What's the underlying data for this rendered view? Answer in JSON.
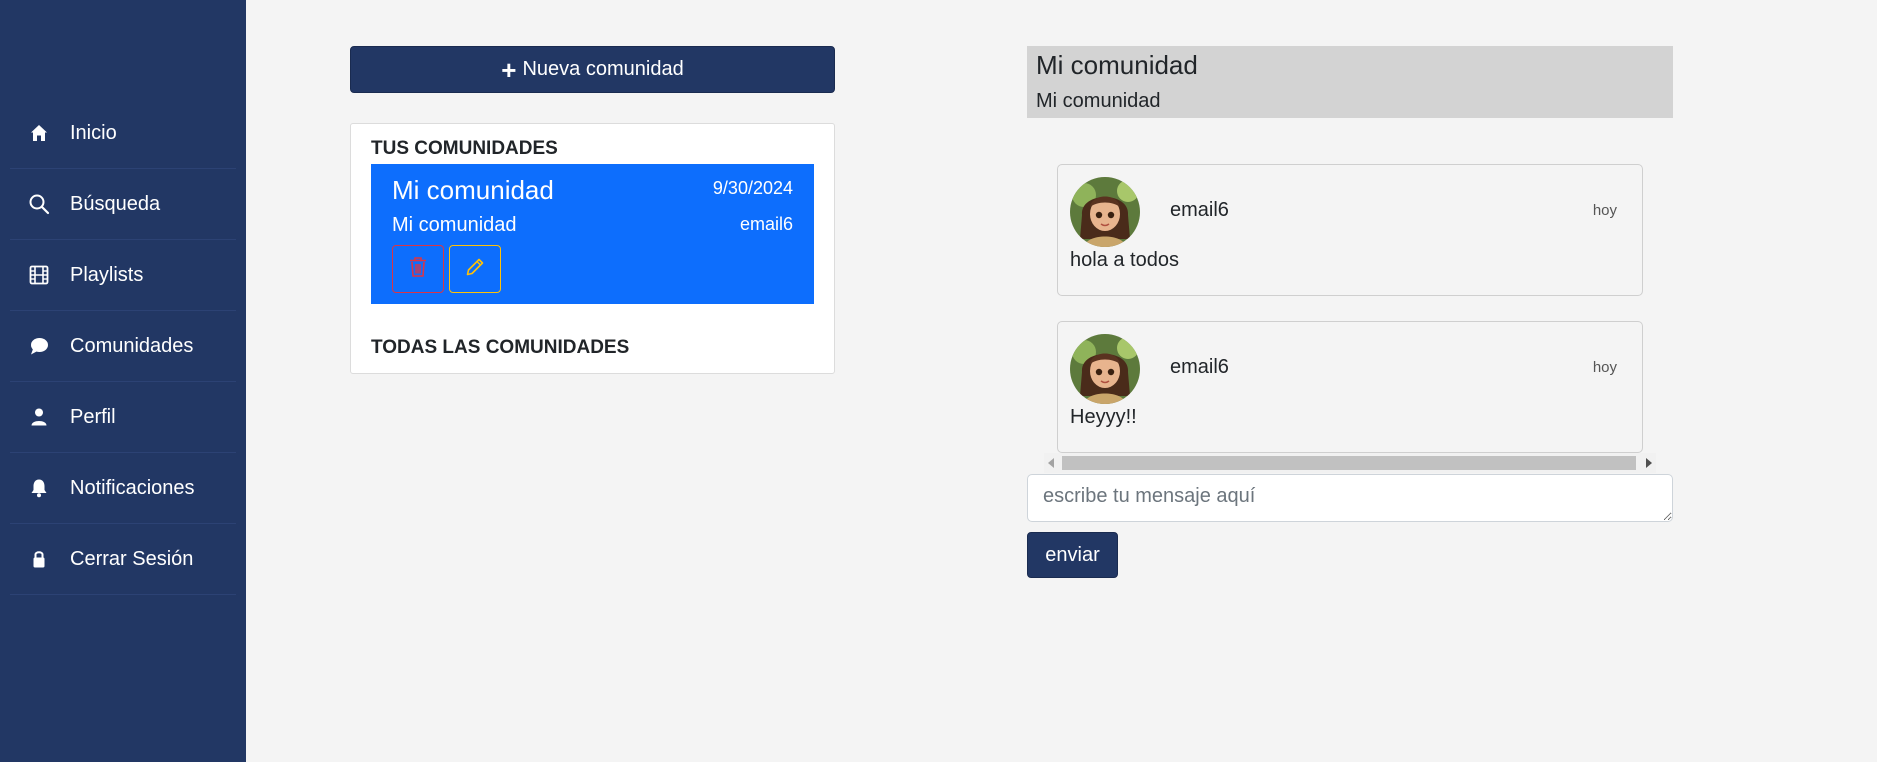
{
  "sidebar": {
    "items": [
      {
        "label": "Inicio",
        "icon": "home-icon"
      },
      {
        "label": "Búsqueda",
        "icon": "search-icon"
      },
      {
        "label": "Playlists",
        "icon": "film-icon"
      },
      {
        "label": "Comunidades",
        "icon": "chat-bubble-icon"
      },
      {
        "label": "Perfil",
        "icon": "user-icon"
      },
      {
        "label": "Notificaciones",
        "icon": "bell-icon"
      },
      {
        "label": "Cerrar Sesión",
        "icon": "lock-icon"
      }
    ]
  },
  "communities": {
    "new_button_label": "Nueva comunidad",
    "my_section_title": "TUS COMUNIDADES",
    "all_section_title": "TODAS LAS COMUNIDADES",
    "my_items": [
      {
        "title": "Mi comunidad",
        "date": "9/30/2024",
        "description": "Mi comunidad",
        "owner": "email6"
      }
    ]
  },
  "chat": {
    "title": "Mi comunidad",
    "description": "Mi comunidad",
    "messages": [
      {
        "user": "email6",
        "time": "hoy",
        "text": "hola a todos"
      },
      {
        "user": "email6",
        "time": "hoy",
        "text": "Heyyy!!"
      }
    ],
    "input_placeholder": "escribe tu mensaje aquí",
    "send_label": "enviar"
  },
  "colors": {
    "sidebar_bg": "#223764",
    "card_bg": "#0d6efd",
    "delete_accent": "#dc3545",
    "edit_accent": "#ffc107",
    "header_bg": "#d3d3d3"
  }
}
